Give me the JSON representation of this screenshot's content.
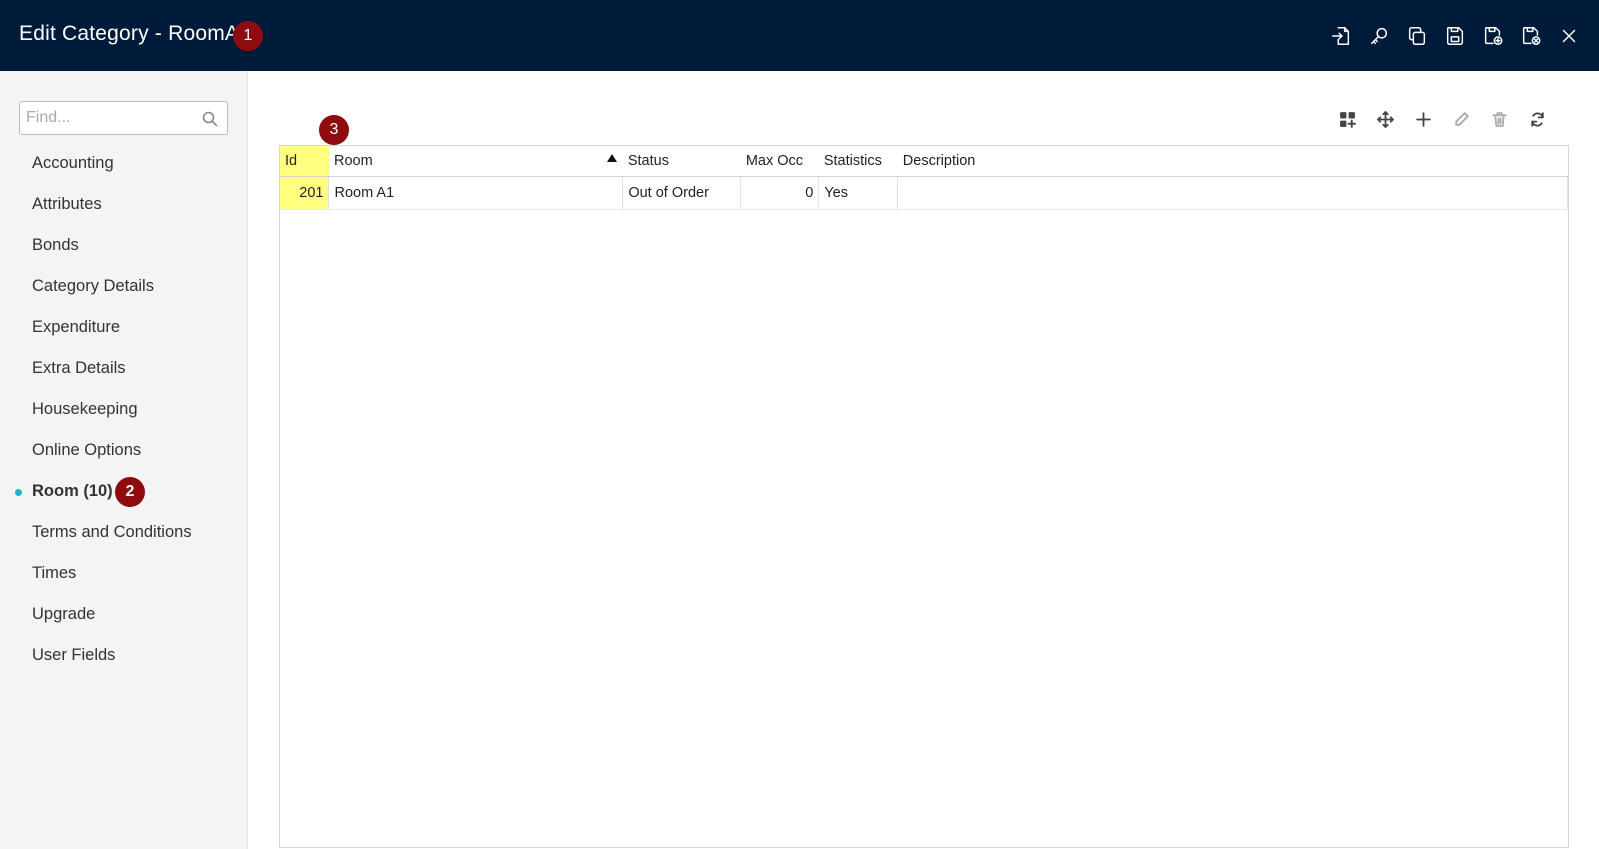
{
  "header": {
    "title": "Edit Category - RoomA",
    "badge": "1",
    "actions": [
      {
        "name": "export-icon"
      },
      {
        "name": "key-icon"
      },
      {
        "name": "copy-icon"
      },
      {
        "name": "save-icon"
      },
      {
        "name": "save-new-icon"
      },
      {
        "name": "save-close-icon"
      },
      {
        "name": "close-icon"
      }
    ]
  },
  "sidebar": {
    "search_placeholder": "Find...",
    "items": [
      {
        "label": "Accounting"
      },
      {
        "label": "Attributes"
      },
      {
        "label": "Bonds"
      },
      {
        "label": "Category Details"
      },
      {
        "label": "Expenditure"
      },
      {
        "label": "Extra Details"
      },
      {
        "label": "Housekeeping"
      },
      {
        "label": "Online Options"
      },
      {
        "label": "Room (10)",
        "active": true,
        "badge": "2"
      },
      {
        "label": "Terms and Conditions"
      },
      {
        "label": "Times"
      },
      {
        "label": "Upgrade"
      },
      {
        "label": "User Fields"
      }
    ]
  },
  "grid": {
    "badge": "3",
    "columns": [
      "Id",
      "Room",
      "Status",
      "Max Occ",
      "Statistics",
      "Description"
    ],
    "rows": [
      {
        "id": "201",
        "room": "Room A1",
        "status": "Out of Order",
        "max_occ": "0",
        "statistics": "Yes",
        "description": ""
      }
    ]
  },
  "colors": {
    "header_bg": "#001b3a",
    "badge": "#8e0c10",
    "active_dot": "#19b6c9",
    "id_column_highlight": "#ffff80"
  }
}
